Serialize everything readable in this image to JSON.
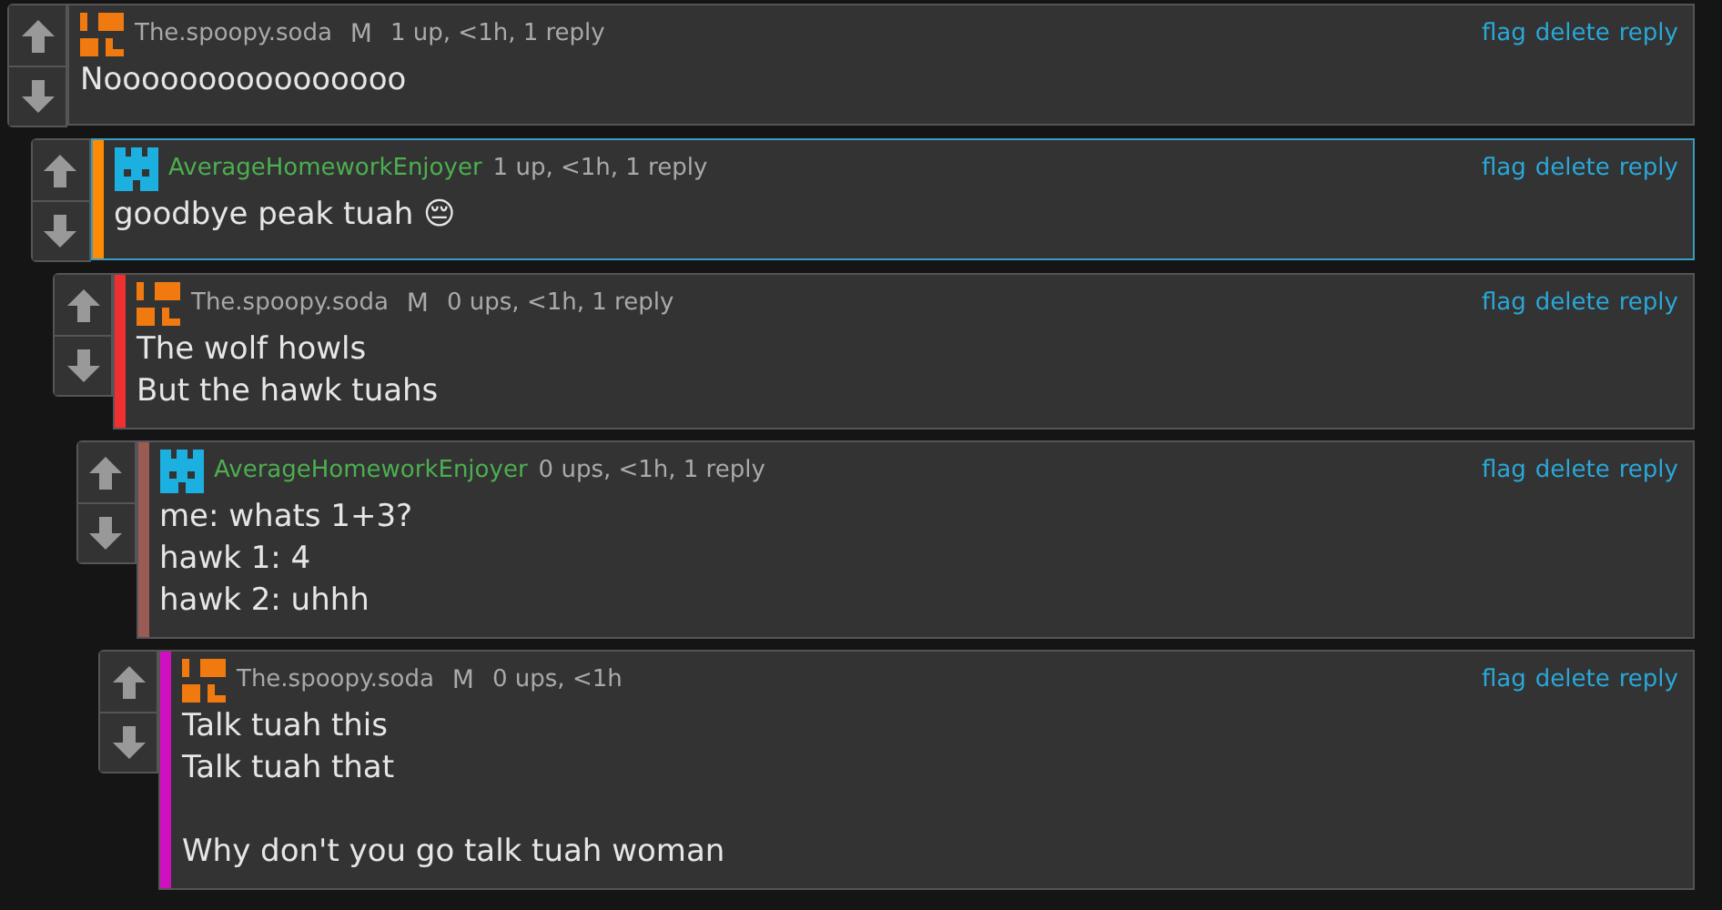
{
  "comments": [
    {
      "author": {
        "name": "The.spoopy.soda",
        "kind": "blocks",
        "color": "#a9a9a9"
      },
      "mod_badge": "M",
      "meta": "1 up, <1h, 1 reply",
      "actions": [
        "flag",
        "delete",
        "reply"
      ],
      "body": "Noooooooooooooooo",
      "highlighted": false,
      "children": [
        {
          "author": {
            "name": "AverageHomeworkEnjoyer",
            "kind": "castle",
            "color": "#4caf50"
          },
          "meta": "1 up, <1h, 1 reply",
          "actions": [
            "flag",
            "delete",
            "reply"
          ],
          "body": "goodbye peak tuah 😔",
          "color": "#ff8c00",
          "highlighted": true,
          "children": [
            {
              "author": {
                "name": "The.spoopy.soda",
                "kind": "blocks",
                "color": "#a9a9a9"
              },
              "mod_badge": "M",
              "meta": "0 ups, <1h, 1 reply",
              "actions": [
                "flag",
                "delete",
                "reply"
              ],
              "body": "The wolf howls\nBut the hawk tuahs",
              "color": "#f03030",
              "highlighted": false,
              "children": [
                {
                  "author": {
                    "name": "AverageHomeworkEnjoyer",
                    "kind": "castle",
                    "color": "#4caf50"
                  },
                  "meta": "0 ups, <1h, 1 reply",
                  "actions": [
                    "flag",
                    "delete",
                    "reply"
                  ],
                  "body": "me: whats 1+3?\nhawk 1: 4\nhawk 2: uhhh",
                  "color": "#9a5a55",
                  "highlighted": false,
                  "children": [
                    {
                      "author": {
                        "name": "The.spoopy.soda",
                        "kind": "blocks",
                        "color": "#a9a9a9"
                      },
                      "mod_badge": "M",
                      "meta": "0 ups, <1h",
                      "actions": [
                        "flag",
                        "delete",
                        "reply"
                      ],
                      "body": "Talk tuah this\nTalk tuah that\n\nWhy don't you go talk tuah woman",
                      "color": "#d010c0",
                      "highlighted": false
                    }
                  ]
                }
              ]
            }
          ]
        }
      ]
    }
  ]
}
